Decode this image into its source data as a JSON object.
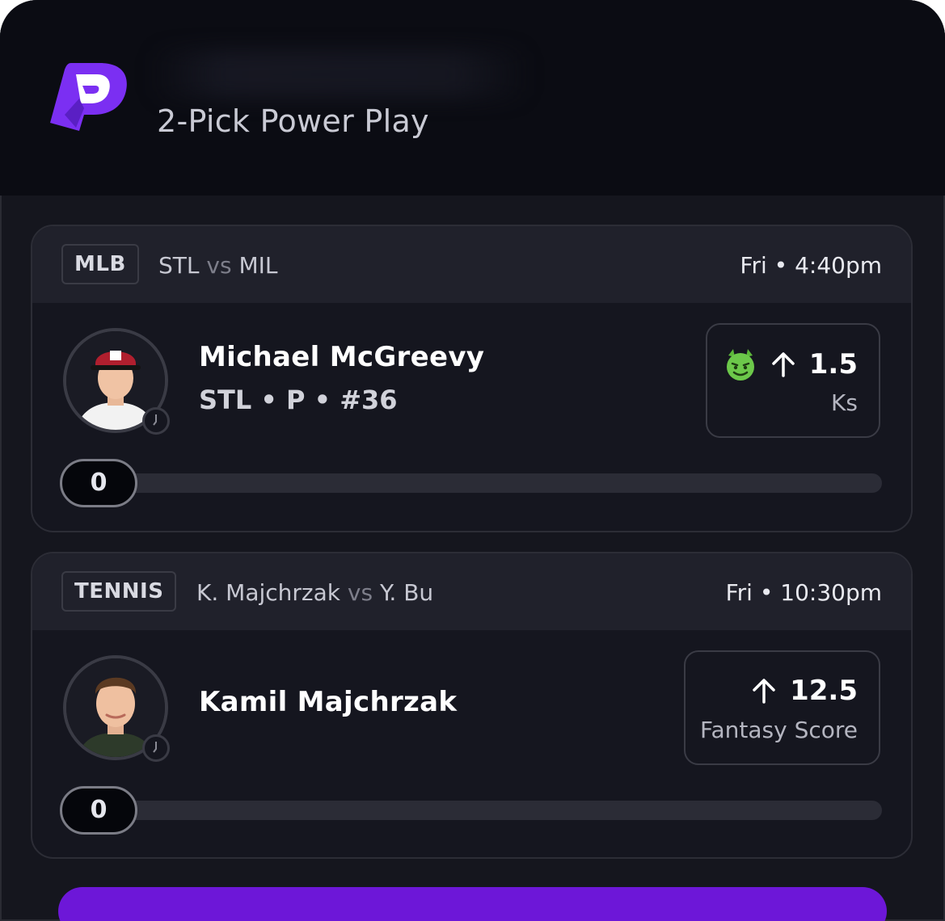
{
  "entry": {
    "title": "2-Pick Power Play"
  },
  "colors": {
    "brand": "#7b2ff2",
    "submit": "#6d17d8",
    "background": "#15161e",
    "header": "#0b0c13"
  },
  "picks": [
    {
      "league": "MLB",
      "team_home": "STL",
      "vs_label": "vs",
      "team_away": "MIL",
      "game_time": "Fri • 4:40pm",
      "player_name": "Michael McGreevy",
      "player_details": "STL • P • #36",
      "badge_icon": "devil-emoji-icon",
      "direction_icon": "arrow-up-icon",
      "line_value": "1.5",
      "stat_type": "Ks",
      "progress_value": "0",
      "progress_fraction": 0
    },
    {
      "league": "TENNIS",
      "team_home": "K. Majchrzak",
      "vs_label": "vs",
      "team_away": "Y. Bu",
      "game_time": "Fri • 10:30pm",
      "player_name": "Kamil Majchrzak",
      "player_details": "",
      "direction_icon": "arrow-up-icon",
      "line_value": "12.5",
      "stat_type": "Fantasy Score",
      "progress_value": "0",
      "progress_fraction": 0
    }
  ]
}
